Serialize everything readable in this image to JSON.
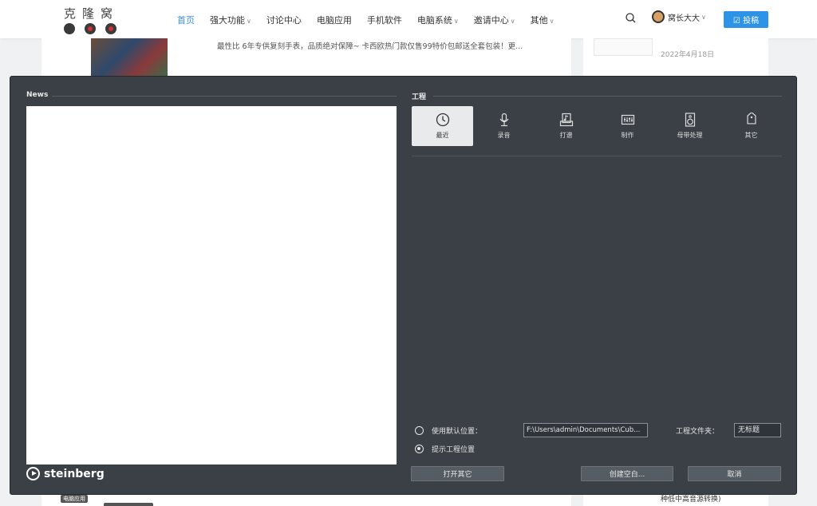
{
  "site": {
    "logo_text": "克隆窝",
    "nav": [
      {
        "label": "首页",
        "dropdown": false
      },
      {
        "label": "强大功能",
        "dropdown": true
      },
      {
        "label": "讨论中心",
        "dropdown": false
      },
      {
        "label": "电脑应用",
        "dropdown": false
      },
      {
        "label": "手机软件",
        "dropdown": false
      },
      {
        "label": "电脑系统",
        "dropdown": true
      },
      {
        "label": "邀请中心",
        "dropdown": true
      },
      {
        "label": "其他",
        "dropdown": true
      }
    ],
    "caret": "∨",
    "user_name": "窝长大大",
    "post_button": "☑ 投稿",
    "post_snippet": "最性比 6年专供复刻手表，品质绝对保障~ 卡西欧热门款仅售99特价包邮送全套包装！更...",
    "side_date": "2022年4月18日",
    "bottom_tag": "电脑应用",
    "bottom_side_text": "种低中高音源转换)",
    "accent_color": "#2d93e6"
  },
  "dialog": {
    "news_title": "News",
    "project_title": "工程",
    "brand": "steinberg",
    "tabs": [
      {
        "label": "最近",
        "icon": "clock-icon",
        "active": true
      },
      {
        "label": "录音",
        "icon": "microphone-icon",
        "active": false
      },
      {
        "label": "打谱",
        "icon": "score-icon",
        "active": false
      },
      {
        "label": "制作",
        "icon": "mixer-icon",
        "active": false
      },
      {
        "label": "母带处理",
        "icon": "speaker-icon",
        "active": false
      },
      {
        "label": "其它",
        "icon": "tag-icon",
        "active": false
      }
    ],
    "option_default_location": "使用默认位置：",
    "option_prompt_location": "提示工程位置",
    "selected_option": "提示工程位置",
    "default_path": "F:\\Users\\admin\\Documents\\Cub...",
    "project_folder_label": "工程文件夹：",
    "project_folder_value": "无标题",
    "btn_open_other": "打开其它",
    "btn_create_empty": "创建空白...",
    "btn_cancel": "取消"
  }
}
